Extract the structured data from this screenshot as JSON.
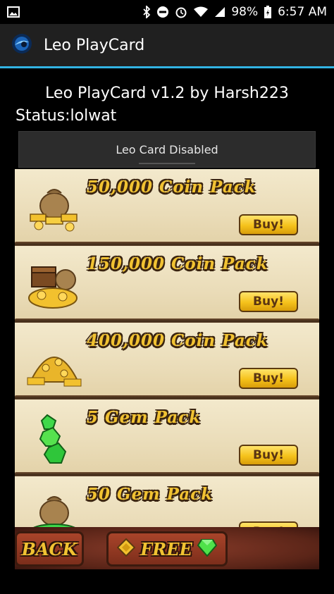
{
  "statusbar": {
    "battery": "98%",
    "time": "6:57 AM",
    "icons": [
      "image-icon",
      "bluetooth-icon",
      "do-not-disturb-icon",
      "alarm-icon",
      "wifi-icon",
      "signal-icon",
      "battery-charging-icon"
    ]
  },
  "appbar": {
    "title": "Leo PlayCard",
    "accent": "#32b4e4"
  },
  "main": {
    "headline": "Leo PlayCard v1.2 by Harsh223",
    "status": "Status:lolwat",
    "toggle_label": "Leo Card Disabled"
  },
  "store": {
    "items": [
      {
        "label": "50,000 Coin Pack",
        "buy": "Buy!",
        "icon": "coin-bag-icon"
      },
      {
        "label": "150,000 Coin Pack",
        "buy": "Buy!",
        "icon": "treasure-chest-icon"
      },
      {
        "label": "400,000 Coin Pack",
        "buy": "Buy!",
        "icon": "gold-pile-icon"
      },
      {
        "label": "5 Gem Pack",
        "buy": "Buy!",
        "icon": "gems-icon"
      },
      {
        "label": "50 Gem Pack",
        "buy": "Buy!",
        "icon": "gem-bag-icon"
      }
    ],
    "back_label": "BACK",
    "free_label": "FREE"
  }
}
